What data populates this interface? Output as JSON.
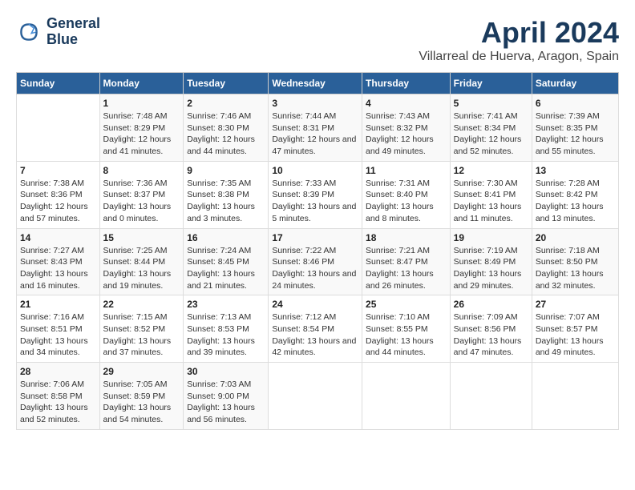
{
  "logo": {
    "line1": "General",
    "line2": "Blue"
  },
  "title": "April 2024",
  "subtitle": "Villarreal de Huerva, Aragon, Spain",
  "days_of_week": [
    "Sunday",
    "Monday",
    "Tuesday",
    "Wednesday",
    "Thursday",
    "Friday",
    "Saturday"
  ],
  "weeks": [
    [
      {
        "num": "",
        "sunrise": "",
        "sunset": "",
        "daylight": ""
      },
      {
        "num": "1",
        "sunrise": "Sunrise: 7:48 AM",
        "sunset": "Sunset: 8:29 PM",
        "daylight": "Daylight: 12 hours and 41 minutes."
      },
      {
        "num": "2",
        "sunrise": "Sunrise: 7:46 AM",
        "sunset": "Sunset: 8:30 PM",
        "daylight": "Daylight: 12 hours and 44 minutes."
      },
      {
        "num": "3",
        "sunrise": "Sunrise: 7:44 AM",
        "sunset": "Sunset: 8:31 PM",
        "daylight": "Daylight: 12 hours and 47 minutes."
      },
      {
        "num": "4",
        "sunrise": "Sunrise: 7:43 AM",
        "sunset": "Sunset: 8:32 PM",
        "daylight": "Daylight: 12 hours and 49 minutes."
      },
      {
        "num": "5",
        "sunrise": "Sunrise: 7:41 AM",
        "sunset": "Sunset: 8:34 PM",
        "daylight": "Daylight: 12 hours and 52 minutes."
      },
      {
        "num": "6",
        "sunrise": "Sunrise: 7:39 AM",
        "sunset": "Sunset: 8:35 PM",
        "daylight": "Daylight: 12 hours and 55 minutes."
      }
    ],
    [
      {
        "num": "7",
        "sunrise": "Sunrise: 7:38 AM",
        "sunset": "Sunset: 8:36 PM",
        "daylight": "Daylight: 12 hours and 57 minutes."
      },
      {
        "num": "8",
        "sunrise": "Sunrise: 7:36 AM",
        "sunset": "Sunset: 8:37 PM",
        "daylight": "Daylight: 13 hours and 0 minutes."
      },
      {
        "num": "9",
        "sunrise": "Sunrise: 7:35 AM",
        "sunset": "Sunset: 8:38 PM",
        "daylight": "Daylight: 13 hours and 3 minutes."
      },
      {
        "num": "10",
        "sunrise": "Sunrise: 7:33 AM",
        "sunset": "Sunset: 8:39 PM",
        "daylight": "Daylight: 13 hours and 5 minutes."
      },
      {
        "num": "11",
        "sunrise": "Sunrise: 7:31 AM",
        "sunset": "Sunset: 8:40 PM",
        "daylight": "Daylight: 13 hours and 8 minutes."
      },
      {
        "num": "12",
        "sunrise": "Sunrise: 7:30 AM",
        "sunset": "Sunset: 8:41 PM",
        "daylight": "Daylight: 13 hours and 11 minutes."
      },
      {
        "num": "13",
        "sunrise": "Sunrise: 7:28 AM",
        "sunset": "Sunset: 8:42 PM",
        "daylight": "Daylight: 13 hours and 13 minutes."
      }
    ],
    [
      {
        "num": "14",
        "sunrise": "Sunrise: 7:27 AM",
        "sunset": "Sunset: 8:43 PM",
        "daylight": "Daylight: 13 hours and 16 minutes."
      },
      {
        "num": "15",
        "sunrise": "Sunrise: 7:25 AM",
        "sunset": "Sunset: 8:44 PM",
        "daylight": "Daylight: 13 hours and 19 minutes."
      },
      {
        "num": "16",
        "sunrise": "Sunrise: 7:24 AM",
        "sunset": "Sunset: 8:45 PM",
        "daylight": "Daylight: 13 hours and 21 minutes."
      },
      {
        "num": "17",
        "sunrise": "Sunrise: 7:22 AM",
        "sunset": "Sunset: 8:46 PM",
        "daylight": "Daylight: 13 hours and 24 minutes."
      },
      {
        "num": "18",
        "sunrise": "Sunrise: 7:21 AM",
        "sunset": "Sunset: 8:47 PM",
        "daylight": "Daylight: 13 hours and 26 minutes."
      },
      {
        "num": "19",
        "sunrise": "Sunrise: 7:19 AM",
        "sunset": "Sunset: 8:49 PM",
        "daylight": "Daylight: 13 hours and 29 minutes."
      },
      {
        "num": "20",
        "sunrise": "Sunrise: 7:18 AM",
        "sunset": "Sunset: 8:50 PM",
        "daylight": "Daylight: 13 hours and 32 minutes."
      }
    ],
    [
      {
        "num": "21",
        "sunrise": "Sunrise: 7:16 AM",
        "sunset": "Sunset: 8:51 PM",
        "daylight": "Daylight: 13 hours and 34 minutes."
      },
      {
        "num": "22",
        "sunrise": "Sunrise: 7:15 AM",
        "sunset": "Sunset: 8:52 PM",
        "daylight": "Daylight: 13 hours and 37 minutes."
      },
      {
        "num": "23",
        "sunrise": "Sunrise: 7:13 AM",
        "sunset": "Sunset: 8:53 PM",
        "daylight": "Daylight: 13 hours and 39 minutes."
      },
      {
        "num": "24",
        "sunrise": "Sunrise: 7:12 AM",
        "sunset": "Sunset: 8:54 PM",
        "daylight": "Daylight: 13 hours and 42 minutes."
      },
      {
        "num": "25",
        "sunrise": "Sunrise: 7:10 AM",
        "sunset": "Sunset: 8:55 PM",
        "daylight": "Daylight: 13 hours and 44 minutes."
      },
      {
        "num": "26",
        "sunrise": "Sunrise: 7:09 AM",
        "sunset": "Sunset: 8:56 PM",
        "daylight": "Daylight: 13 hours and 47 minutes."
      },
      {
        "num": "27",
        "sunrise": "Sunrise: 7:07 AM",
        "sunset": "Sunset: 8:57 PM",
        "daylight": "Daylight: 13 hours and 49 minutes."
      }
    ],
    [
      {
        "num": "28",
        "sunrise": "Sunrise: 7:06 AM",
        "sunset": "Sunset: 8:58 PM",
        "daylight": "Daylight: 13 hours and 52 minutes."
      },
      {
        "num": "29",
        "sunrise": "Sunrise: 7:05 AM",
        "sunset": "Sunset: 8:59 PM",
        "daylight": "Daylight: 13 hours and 54 minutes."
      },
      {
        "num": "30",
        "sunrise": "Sunrise: 7:03 AM",
        "sunset": "Sunset: 9:00 PM",
        "daylight": "Daylight: 13 hours and 56 minutes."
      },
      {
        "num": "",
        "sunrise": "",
        "sunset": "",
        "daylight": ""
      },
      {
        "num": "",
        "sunrise": "",
        "sunset": "",
        "daylight": ""
      },
      {
        "num": "",
        "sunrise": "",
        "sunset": "",
        "daylight": ""
      },
      {
        "num": "",
        "sunrise": "",
        "sunset": "",
        "daylight": ""
      }
    ]
  ]
}
